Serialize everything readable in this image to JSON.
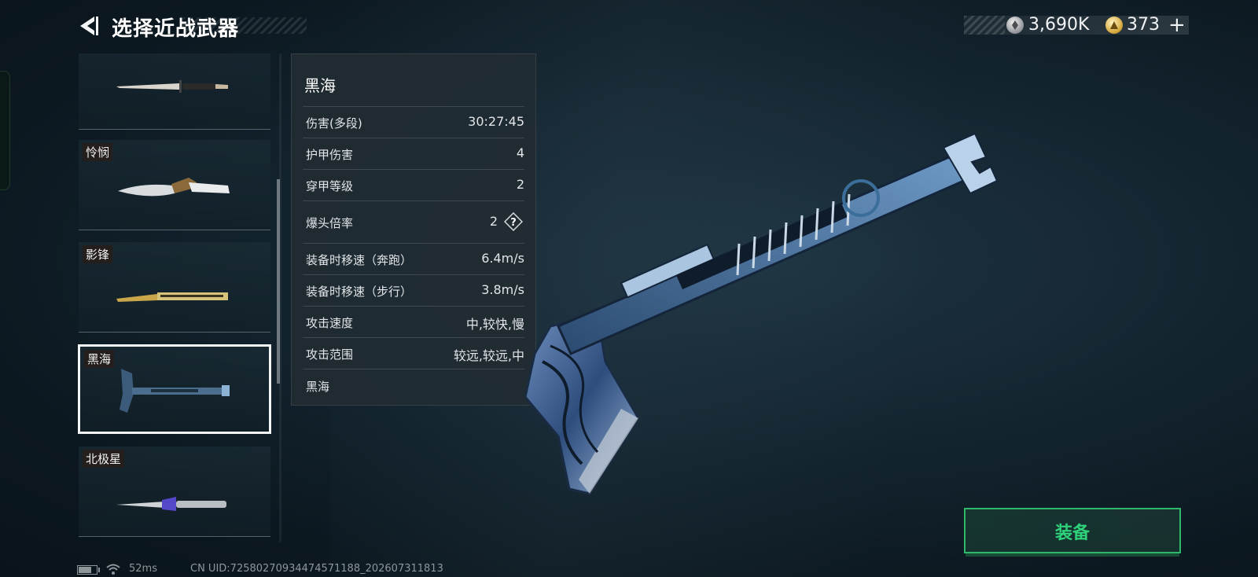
{
  "header": {
    "title": "选择近战武器",
    "currency": [
      {
        "icon": "silver-coin-icon",
        "value": "3,690K"
      },
      {
        "icon": "gold-coin-icon",
        "value": "373"
      }
    ],
    "plus_label": "+"
  },
  "weapons": [
    {
      "label": "",
      "selected": false
    },
    {
      "label": "怜悯",
      "selected": false
    },
    {
      "label": "影锋",
      "selected": false
    },
    {
      "label": "黑海",
      "selected": true
    },
    {
      "label": "北极星",
      "selected": false
    }
  ],
  "stats_panel": {
    "title": "黑海",
    "rows": [
      {
        "key": "伤害(多段)",
        "value": "30:27:45"
      },
      {
        "key": "护甲伤害",
        "value": "4"
      },
      {
        "key": "穿甲等级",
        "value": "2"
      },
      {
        "key": "爆头倍率",
        "value": "2"
      },
      {
        "key": "装备时移速（奔跑）",
        "value": "6.4m/s"
      },
      {
        "key": "装备时移速（步行）",
        "value": "3.8m/s"
      },
      {
        "key": "攻击速度",
        "value": "中,较快,慢"
      },
      {
        "key": "攻击范围",
        "value": "较远,较远,中"
      }
    ],
    "footer": "黑海",
    "help_glyph": "?"
  },
  "equip_button": {
    "label": "装备"
  },
  "status_bar": {
    "ping": "52ms",
    "uid": "CN UID:7258027093447457118​8_202607311813"
  },
  "colors": {
    "accent_green": "#2ed27a",
    "panel_bg": "#212b32",
    "background": "#0c1820"
  }
}
